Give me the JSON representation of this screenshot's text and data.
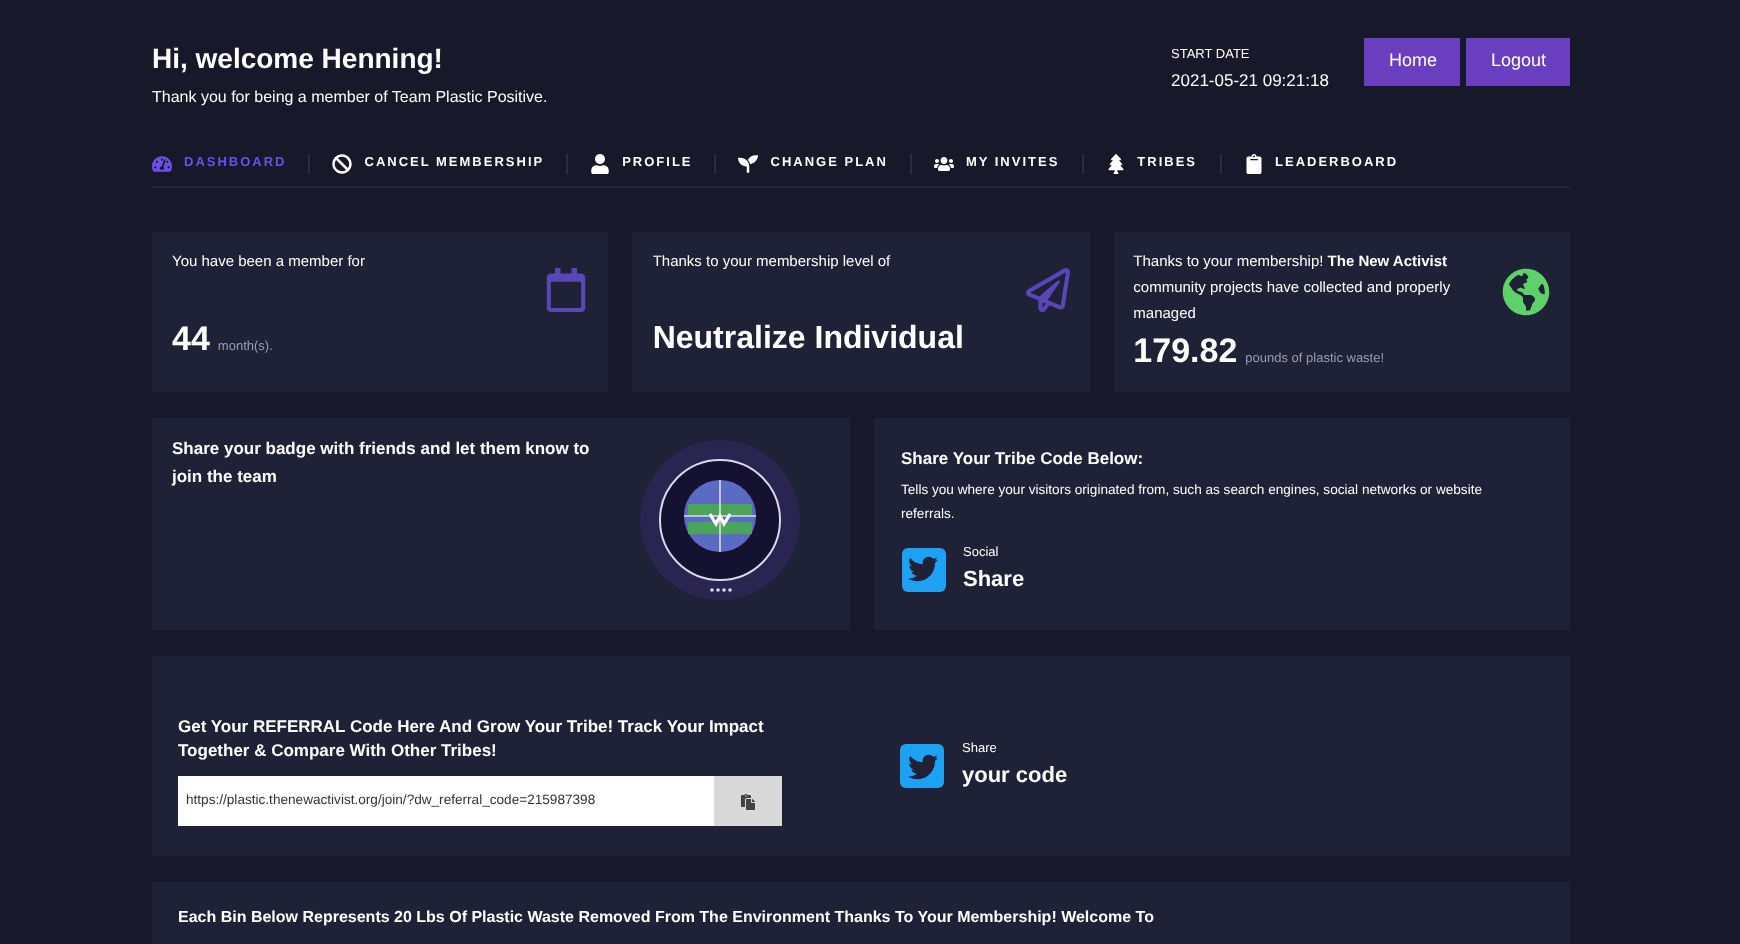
{
  "header": {
    "greeting": "Hi, welcome Henning!",
    "subtitle": "Thank you for being a member of Team Plastic Positive.",
    "start_date_label": "START DATE",
    "start_date": "2021-05-21 09:21:18",
    "buttons": [
      "Home",
      "Logout"
    ]
  },
  "nav": [
    {
      "label": "DASHBOARD",
      "selected": true
    },
    {
      "label": "CANCEL MEMBERSHIP",
      "selected": false
    },
    {
      "label": "PROFILE",
      "selected": false
    },
    {
      "label": "CHANGE PLAN",
      "selected": false
    },
    {
      "label": "MY INVITES",
      "selected": false
    },
    {
      "label": "TRIBES",
      "selected": false
    },
    {
      "label": "LEADERBOARD",
      "selected": false
    }
  ],
  "stats": [
    {
      "caption": "You have been a member for",
      "value": "44",
      "unit": "month(s)."
    },
    {
      "caption": "Thanks to your membership level of",
      "value": "Neutralize Individual"
    },
    {
      "caption": "Thanks to your membership! **The New Activist** community projects have collected and properly managed",
      "value": "179.82",
      "unit": "pounds of plastic waste!"
    }
  ],
  "badge_card": {
    "text": "Share your badge with friends and let them know to join the team"
  },
  "tribe_card": {
    "title": "Share Your Tribe Code Below:",
    "description": "Tells you where your visitors originated from, such as search engines, social networks or website referrals.",
    "share_small": "Social",
    "share_big": "Share"
  },
  "referral_card": {
    "title": "Get Your REFERRAL Code Here And Grow Your Tribe! Track Your Impact Together & Compare With Other Tribes!",
    "url": "https://plastic.thenewactivist.org/join/?dw_referral_code=215987398",
    "share_small": "Share",
    "share_big": "your code"
  },
  "bins_card": {
    "text": "Each Bin Below Represents **20 Lbs** Of Plastic Waste Removed From The Environment Thanks To Your Membership! Welcome To"
  }
}
